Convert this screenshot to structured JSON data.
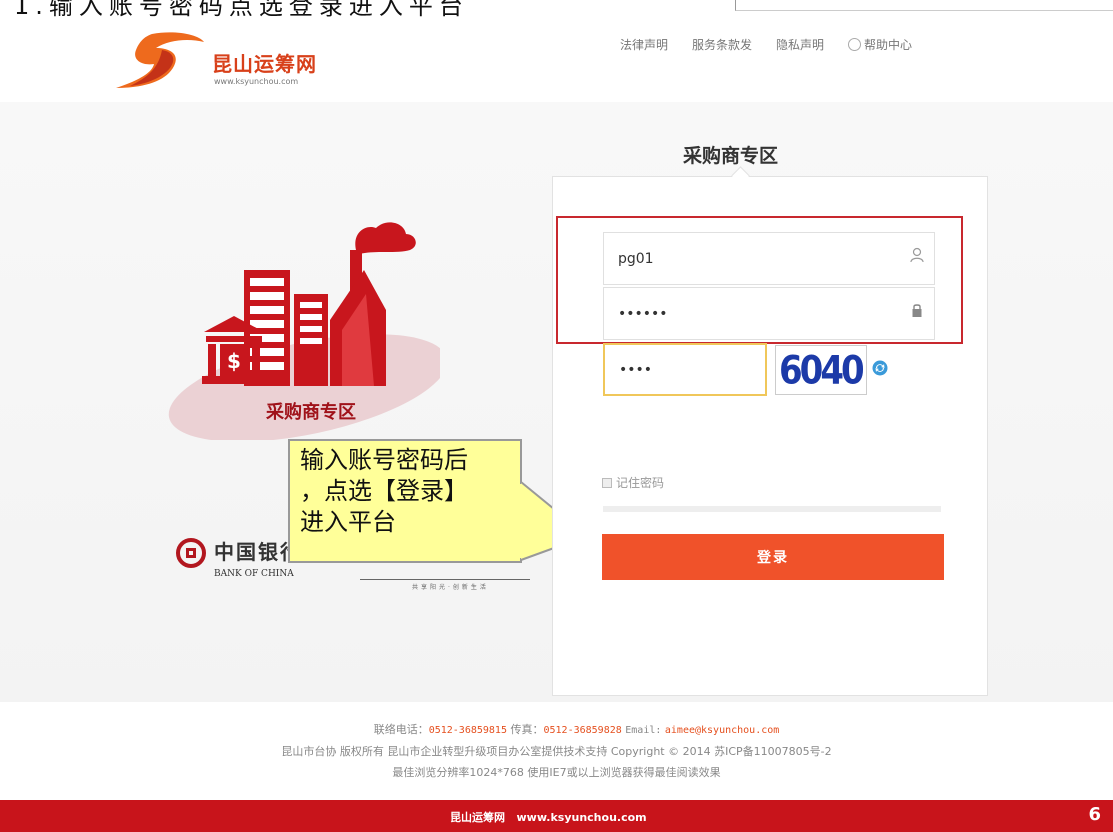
{
  "top_caption": "1.输入账号密码点选登录进入平台",
  "header": {
    "brand_name": "昆山运筹网",
    "brand_url": "www.ksyunchou.com",
    "nav": [
      "法律声明",
      "服务条款发",
      "隐私声明",
      "帮助中心"
    ]
  },
  "illustration": {
    "label": "采购商专区"
  },
  "banks": {
    "boc_cn": "中国银行",
    "boc_en": "BANK OF CHINA",
    "bank2_slogan": "共享阳光·创新生活"
  },
  "callout": {
    "lines": [
      "输入账号密码后",
      "，点选【登录】",
      "进入平台"
    ]
  },
  "form": {
    "title": "采购商专区",
    "username": "pg01",
    "password": "••••••",
    "captcha_value": "••••",
    "captcha_code": "6040",
    "remember_label": "记住密码",
    "login_label": "登录"
  },
  "footer": {
    "phone_label": "联络电话：",
    "phone": "0512-36859815",
    "fax_label": "传真：",
    "fax": "0512-36859828",
    "email_label": "Email:",
    "email": "aimee@ksyunchou.com",
    "line2": "昆山市台协  版权所有  昆山市企业转型升级项目办公室提供技术支持  Copyright © 2014  苏ICP备11007805号-2",
    "line3": "最佳浏览分辨率1024*768  使用IE7或以上浏览器获得最佳阅读效果"
  },
  "bottom_bar": {
    "brand": "昆山运筹网",
    "url": "www.ksyunchou.com",
    "page_number": "6"
  },
  "colors": {
    "accent": "#f0522a",
    "brand_red": "#c8141b",
    "callout_bg": "#ffff99",
    "captcha_blue": "#1c3aa8"
  }
}
